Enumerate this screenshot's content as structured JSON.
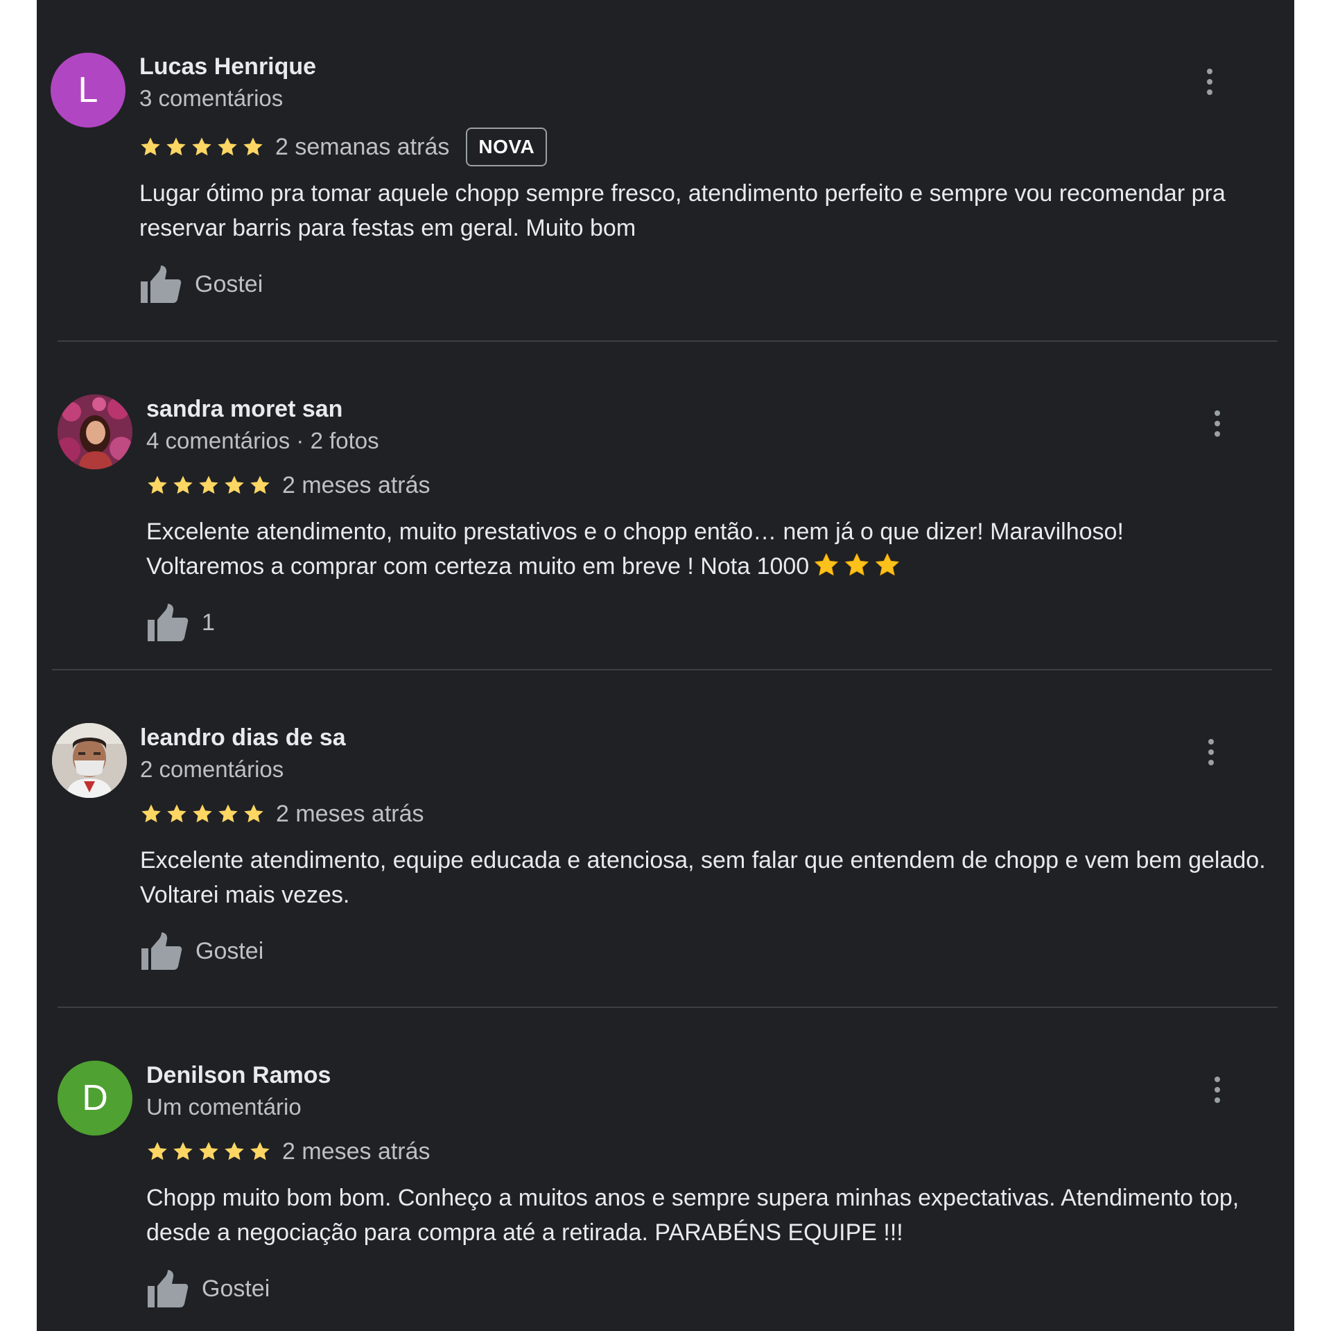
{
  "reviews": [
    {
      "name": "Lucas Henrique",
      "meta": "3 comentários",
      "avatar_letter": "L",
      "avatar_color": "#b146c2",
      "rating": 5,
      "date": "2 semanas atrás",
      "badge": "NOVA",
      "text": "Lugar ótimo pra tomar aquele chopp sempre fresco, atendimento perfeito e sempre vou recomendar pra reservar barris para festas em geral. Muito bom",
      "like_label": "Gostei"
    },
    {
      "name": "sandra moret san",
      "meta": "4 comentários · 2 fotos",
      "rating": 5,
      "date": "2 meses atrás",
      "text_line1": "Excelente atendimento, muito prestativos e o chopp então… nem já o que dizer! Maravilhoso!",
      "text_line2": "Voltaremos a comprar com certeza muito em breve ! Nota 1000",
      "like_label": "1"
    },
    {
      "name": "leandro dias de sa",
      "meta": "2 comentários",
      "rating": 5,
      "date": "2 meses atrás",
      "text": "Excelente atendimento, equipe educada e atenciosa, sem falar que entendem de chopp e vem bem gelado. Voltarei mais vezes.",
      "like_label": "Gostei"
    },
    {
      "name": "Denilson Ramos",
      "meta": "Um comentário",
      "avatar_letter": "D",
      "avatar_color": "#4fa132",
      "rating": 5,
      "date": "2 meses atrás",
      "text": "Chopp muito bom bom. Conheço a muitos anos e sempre supera minhas expectativas. Atendimento top, desde a negociação para compra até a retirada. PARABÉNS EQUIPE !!!",
      "like_label": "Gostei"
    }
  ],
  "colors": {
    "background": "#202124",
    "star": "#fdd663",
    "text": "#e8eaed",
    "secondary_text": "#bdc1c6"
  },
  "icons": {
    "star": "star-icon",
    "like": "thumbs-up-icon",
    "more": "more-vert-icon"
  }
}
